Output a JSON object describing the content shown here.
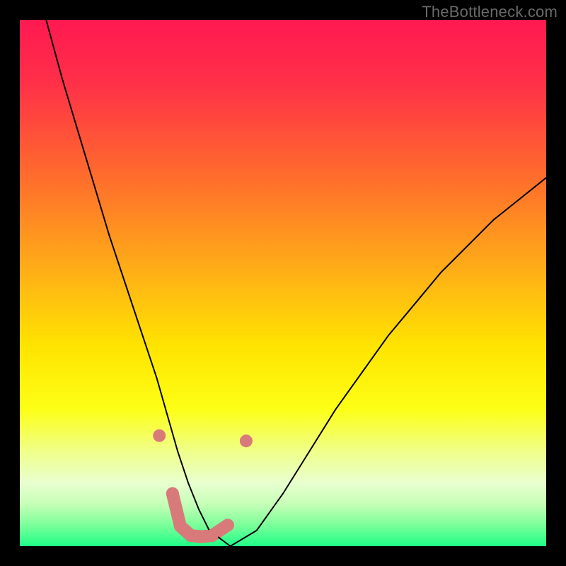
{
  "watermark": "TheBottleneck.com",
  "chart_data": {
    "type": "line",
    "title": "",
    "xlabel": "",
    "ylabel": "",
    "xlim": [
      0,
      100
    ],
    "ylim": [
      0,
      100
    ],
    "background_gradient": {
      "stops": [
        {
          "y_pct": 0,
          "color": "#ff1951"
        },
        {
          "y_pct": 12,
          "color": "#ff3048"
        },
        {
          "y_pct": 30,
          "color": "#ff6d2c"
        },
        {
          "y_pct": 50,
          "color": "#ffb714"
        },
        {
          "y_pct": 62,
          "color": "#ffe400"
        },
        {
          "y_pct": 74,
          "color": "#fdff16"
        },
        {
          "y_pct": 82,
          "color": "#f0ff8a"
        },
        {
          "y_pct": 88,
          "color": "#e8ffcf"
        },
        {
          "y_pct": 92,
          "color": "#c6ffb7"
        },
        {
          "y_pct": 96,
          "color": "#7bff9a"
        },
        {
          "y_pct": 100,
          "color": "#1fff88"
        }
      ]
    },
    "series": [
      {
        "name": "bottleneck-curve",
        "stroke": "#000000",
        "stroke_width": 2,
        "x": [
          5,
          8,
          11,
          14,
          17,
          20,
          23,
          26,
          28,
          30,
          32,
          34,
          36,
          40,
          45,
          50,
          55,
          60,
          65,
          70,
          75,
          80,
          85,
          90,
          95,
          100
        ],
        "y": [
          100,
          89,
          79,
          69,
          59,
          50,
          41,
          32,
          25,
          18,
          12,
          7,
          3,
          0,
          3,
          10,
          18,
          26,
          33,
          40,
          46,
          52,
          57,
          62,
          66,
          70
        ]
      }
    ],
    "points": {
      "name": "highlight-points",
      "color": "#d97a7a",
      "radius": 9,
      "x": [
        26.5,
        29.0,
        30.5,
        32.5,
        34.5,
        36.5,
        39.5,
        43.0
      ],
      "y": [
        21.0,
        10.0,
        3.8,
        2.0,
        1.8,
        2.0,
        4.0,
        20.0
      ]
    },
    "band": {
      "name": "valley-band",
      "color": "#d97a7a",
      "thickness": 18,
      "x": [
        29.0,
        30.5,
        32.5,
        34.5,
        36.5,
        39.5
      ],
      "y": [
        10.0,
        3.8,
        2.0,
        1.8,
        2.0,
        4.0
      ]
    }
  }
}
